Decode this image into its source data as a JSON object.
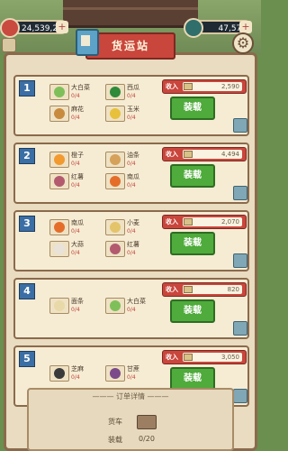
{
  "resources": {
    "left_value": "24,539,250",
    "right_value": "47,575",
    "plus": "+"
  },
  "title": "货运站",
  "orders": [
    {
      "number": "1",
      "items": [
        {
          "name": "大白菜",
          "qty": "0/4",
          "color": "#7fbf5a"
        },
        {
          "name": "西瓜",
          "qty": "0/4",
          "color": "#2f8a3a"
        },
        {
          "name": "麻花",
          "qty": "0/4",
          "color": "#c88a3c"
        },
        {
          "name": "玉米",
          "qty": "0/4",
          "color": "#e7c13b"
        }
      ],
      "income_label": "收入",
      "income": "2,590",
      "button": "装载"
    },
    {
      "number": "2",
      "items": [
        {
          "name": "橙子",
          "qty": "0/4",
          "color": "#f29a2f"
        },
        {
          "name": "油条",
          "qty": "0/4",
          "color": "#d6a15a"
        },
        {
          "name": "红薯",
          "qty": "0/4",
          "color": "#b35a6f"
        },
        {
          "name": "南瓜",
          "qty": "0/4",
          "color": "#e56d2a"
        }
      ],
      "income_label": "收入",
      "income": "4,494",
      "button": "装载"
    },
    {
      "number": "3",
      "items": [
        {
          "name": "南瓜",
          "qty": "0/4",
          "color": "#e56d2a"
        },
        {
          "name": "小麦",
          "qty": "0/4",
          "color": "#e4c46a"
        },
        {
          "name": "大蒜",
          "qty": "0/4",
          "color": "#e8e2d8"
        },
        {
          "name": "红薯",
          "qty": "0/4",
          "color": "#b35a6f"
        }
      ],
      "income_label": "收入",
      "income": "2,070",
      "button": "装载"
    },
    {
      "number": "4",
      "items": [
        {
          "name": "面条",
          "qty": "0/4",
          "color": "#e9d8a8"
        },
        {
          "name": "大白菜",
          "qty": "0/4",
          "color": "#7fbf5a"
        }
      ],
      "income_label": "收入",
      "income": "820",
      "button": "装载"
    },
    {
      "number": "5",
      "items": [
        {
          "name": "芝麻",
          "qty": "0/4",
          "color": "#3a3a3a"
        },
        {
          "name": "甘蔗",
          "qty": "0/4",
          "color": "#7a4a8a"
        }
      ],
      "income_label": "收入",
      "income": "3,050",
      "button": "装载"
    }
  ],
  "footer": {
    "title": "订单详情",
    "truck_label": "货车",
    "load_label": "装载",
    "load_value": "0/20"
  }
}
